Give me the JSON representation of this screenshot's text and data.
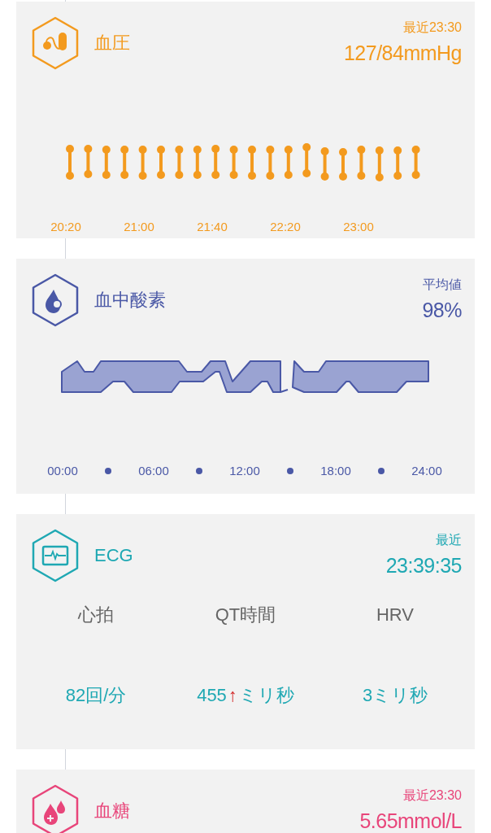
{
  "cards": [
    {
      "kind": "blood_pressure",
      "color": "#f39a1e",
      "title": "血圧",
      "caption": "最近23:30",
      "value": "127/84mmHg",
      "chart": {
        "kind": "bars",
        "x_labels": [
          "20:20",
          "21:00",
          "21:40",
          "22:20",
          "23:00"
        ]
      }
    },
    {
      "kind": "blood_oxygen",
      "color": "#4a58a6",
      "title": "血中酸素",
      "caption": "平均値",
      "value": "98%",
      "chart": {
        "kind": "band",
        "x_labels": [
          "00:00",
          "06:00",
          "12:00",
          "18:00",
          "24:00"
        ]
      }
    },
    {
      "kind": "ecg",
      "color": "#1fa8b3",
      "title": "ECG",
      "caption": "最近",
      "value": "23:39:35",
      "stats": [
        {
          "label": "心拍",
          "value": "82回/分"
        },
        {
          "label": "QT時間",
          "value": "455",
          "arrow": "↑",
          "unit": "ミリ秒"
        },
        {
          "label": "HRV",
          "value": "3ミリ秒"
        }
      ]
    },
    {
      "kind": "glucose",
      "color": "#e8457a",
      "title": "血糖",
      "caption": "最近23:30",
      "value": "5.65mmol/L"
    }
  ]
}
